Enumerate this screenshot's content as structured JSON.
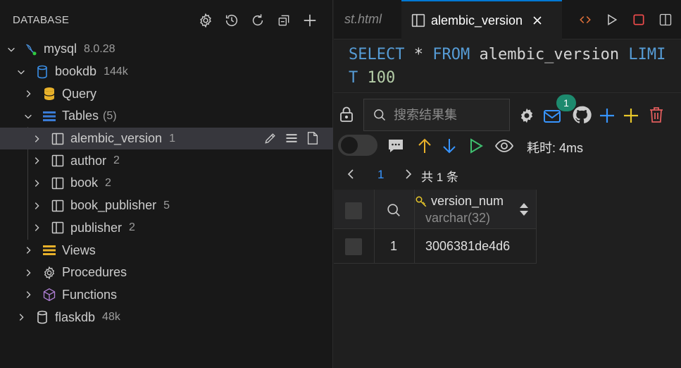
{
  "sidebar": {
    "title": "DATABASE",
    "connection": {
      "name": "mysql",
      "version": "8.0.28"
    },
    "database": {
      "name": "bookdb",
      "size": "144k"
    },
    "query_label": "Query",
    "tables_label": "Tables",
    "tables_count": "(5)",
    "tables": [
      {
        "name": "alembic_version",
        "count": "1"
      },
      {
        "name": "author",
        "count": "2"
      },
      {
        "name": "book",
        "count": "2"
      },
      {
        "name": "book_publisher",
        "count": "5"
      },
      {
        "name": "publisher",
        "count": "2"
      }
    ],
    "views_label": "Views",
    "procedures_label": "Procedures",
    "functions_label": "Functions",
    "other_db": {
      "name": "flaskdb",
      "size": "48k"
    }
  },
  "tabs": {
    "previous": "st.html",
    "active": "alembic_version"
  },
  "sql": {
    "line1": {
      "kw1": "SELECT",
      "star": "*",
      "kw2": "FROM",
      "table": "alembic_version",
      "kw3": "LIMI"
    },
    "line2": {
      "kw": "T",
      "num": "100"
    }
  },
  "results": {
    "search_placeholder": "搜索结果集",
    "notification_count": "1",
    "elapsed": "耗时: 4ms",
    "page": "1",
    "total": "共 1 条",
    "column": {
      "name": "version_num",
      "type": "varchar(32)"
    },
    "rows": [
      {
        "index": "1",
        "version_num": "3006381de4d6"
      }
    ]
  },
  "colors": {
    "accent": "#0078d4",
    "badge": "#1d8a6e",
    "plus": "#3794ff",
    "plus_yellow": "#e8c72a",
    "trash": "#e05d5d",
    "query_icon": "#e8b12a",
    "tables_icon": "#3a7bd5",
    "functions_icon": "#b180d7"
  }
}
